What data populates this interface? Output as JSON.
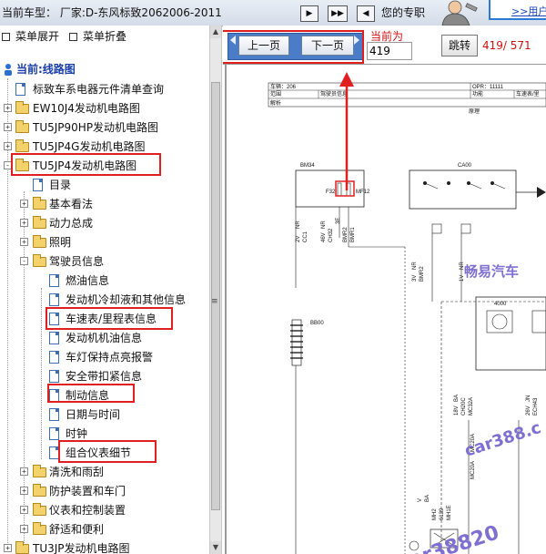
{
  "top_bar": {
    "car_title": "当前车型： 厂家:D-东风标致2062006-2011",
    "icons": [
      "play-icon",
      "double-play-icon",
      "step-icon"
    ],
    "ad_text": "您的专职",
    "ad_link": ">>用户"
  },
  "tree": {
    "expand_all": "菜单展开",
    "collapse_all": "菜单折叠",
    "current_label": "当前:线路图",
    "items": [
      {
        "label": "标致车系电器元件清单查询",
        "type": "doc"
      },
      {
        "label": "EW10J4发动机电路图",
        "type": "folder"
      },
      {
        "label": "TU5JP90HP发动机电路图",
        "type": "folder"
      },
      {
        "label": "TU5JP4G发动机电路图",
        "type": "folder"
      },
      {
        "label": "TU5JP4发动机电路图",
        "type": "folder-open"
      },
      {
        "label": "目录",
        "type": "doc"
      },
      {
        "label": "基本看法",
        "type": "folder"
      },
      {
        "label": "动力总成",
        "type": "folder"
      },
      {
        "label": "照明",
        "type": "folder"
      },
      {
        "label": "驾驶员信息",
        "type": "folder-open"
      },
      {
        "label": "燃油信息",
        "type": "doc"
      },
      {
        "label": "发动机冷却液和其他信息",
        "type": "doc"
      },
      {
        "label": "车速表/里程表信息",
        "type": "doc"
      },
      {
        "label": "发动机机油信息",
        "type": "doc"
      },
      {
        "label": "车灯保持点亮报警",
        "type": "doc"
      },
      {
        "label": "安全带扣紧信息",
        "type": "doc"
      },
      {
        "label": "制动信息",
        "type": "doc"
      },
      {
        "label": "日期与时间",
        "type": "doc"
      },
      {
        "label": "时钟",
        "type": "doc"
      },
      {
        "label": "组合仪表细节",
        "type": "doc"
      },
      {
        "label": "清洗和雨刮",
        "type": "folder"
      },
      {
        "label": "防护装置和车门",
        "type": "folder"
      },
      {
        "label": "仪表和控制装置",
        "type": "folder"
      },
      {
        "label": "舒适和便利",
        "type": "folder"
      },
      {
        "label": "TU3JP发动机电路图",
        "type": "folder"
      }
    ]
  },
  "nav": {
    "prev_label": "上一页",
    "next_label": "下一页",
    "page_label": "当前为",
    "page_value": "419",
    "jump_label": "跳转",
    "page_count": "419/ 571"
  },
  "diagram": {
    "header": {
      "vehicle": "车辆：206",
      "opr": "OPR：11111",
      "row2_col1": "范围",
      "row2_col2": "驾驶员信息",
      "row2_col3": "功能",
      "row2_col4": "车速表/里",
      "row3_col1": "解析",
      "row3_center": "原理"
    },
    "components": [
      "BM34",
      "CA00",
      "BB00",
      "4000"
    ],
    "pins": [
      "F32",
      "MF12"
    ],
    "wire_labels": [
      "2V",
      "NR",
      "CC1",
      "46V",
      "NR",
      "CH32",
      "3E",
      "BMR2",
      "BMR1",
      "3V",
      "NR",
      "BMR2",
      "1V",
      "NR",
      "18V",
      "BA",
      "CH20C",
      "MC32A",
      "26V",
      "JN",
      "ECH43",
      "MC20A",
      "MC20A",
      "V",
      "BA",
      "MH2",
      "6139",
      "MH1E"
    ],
    "watermarks": [
      "畅易汽车",
      "car388.c",
      "car38820"
    ]
  }
}
